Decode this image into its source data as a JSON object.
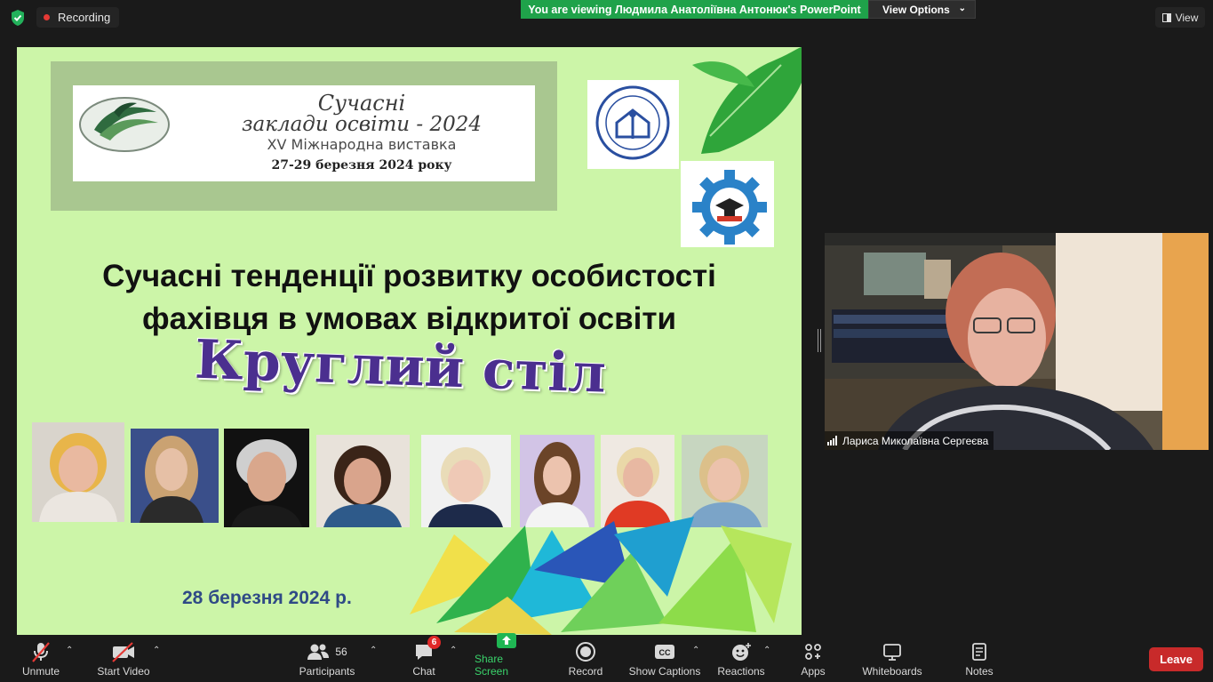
{
  "topbar": {
    "recording_label": "Recording",
    "viewing_banner": "You are viewing Людмила Анатоліївна Антонюк's PowerPoint",
    "view_options_label": "View Options",
    "view_label": "View"
  },
  "slide": {
    "banner": {
      "line1": "Сучасні",
      "line2": "заклади освіти - 2024",
      "line3": "XV Міжнародна виставка",
      "line4": "27-29 березня 2024 року"
    },
    "title_line1": "Сучасні тенденції розвитку особистості",
    "title_line2": "фахівця в умовах відкритої освіти",
    "subtitle": "Круглий стіл",
    "date": "28 березня 2024 р."
  },
  "video": {
    "participant_name": "Лариса Миколаївна Сергеєва"
  },
  "toolbar": {
    "unmute": "Unmute",
    "start_video": "Start Video",
    "participants": "Participants",
    "participants_count": "56",
    "chat": "Chat",
    "chat_badge": "6",
    "share_screen": "Share Screen",
    "record": "Record",
    "show_captions": "Show Captions",
    "reactions": "Reactions",
    "apps": "Apps",
    "whiteboards": "Whiteboards",
    "notes": "Notes",
    "leave": "Leave"
  },
  "colors": {
    "share_green": "#1fa24a",
    "leave_red": "#c82a2a",
    "slide_bg": "#ccf5a8",
    "roundtable_purple": "#4b2f8f"
  }
}
